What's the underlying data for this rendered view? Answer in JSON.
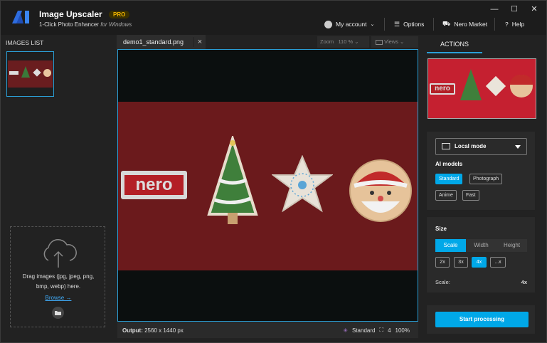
{
  "app": {
    "title": "Image Upscaler",
    "badge": "PRO",
    "subtitle": "1-Click Photo Enhancer",
    "subtitle_suffix": "for Windows"
  },
  "window_controls": {
    "minimize": "—",
    "maximize": "☐",
    "close": "✕"
  },
  "topnav": {
    "account": "My account",
    "options": "Options",
    "market": "Nero Market",
    "help": "Help"
  },
  "images_list": {
    "header": "IMAGES LIST",
    "drop_text_1": "Drag images (jpg, jpeg, png,",
    "drop_text_2": "bmp, webp) here.",
    "browse": "Browse →"
  },
  "center": {
    "tab_label": "demo1_standard.png",
    "zoom_label": "Zoom",
    "zoom_value": "110 %",
    "views_label": "Views",
    "photo_text": "nero"
  },
  "status": {
    "output_label": "Output:",
    "output_value": "2560 x 1440 px",
    "model": "Standard",
    "scale": "4",
    "zoom": "100%"
  },
  "actions": {
    "tab": "ACTIONS",
    "preview_text": "nero",
    "mode": "Local mode",
    "ai_models_label": "AI models",
    "models": [
      "Standard",
      "Photograph",
      "Anime",
      "Fast"
    ],
    "selected_model": "Standard",
    "size_label": "Size",
    "size_tabs": [
      "Scale",
      "Width",
      "Height"
    ],
    "selected_size_tab": "Scale",
    "scales": [
      "2x",
      "3x",
      "4x",
      "...x"
    ],
    "selected_scale": "4x",
    "scale_label": "Scale:",
    "scale_value": "4x",
    "start": "Start processing"
  },
  "colors": {
    "accent": "#00a8e8",
    "selection_border": "#2b9fd6",
    "pro": "#f0b400",
    "photo_bg": "#6b1a1c"
  }
}
